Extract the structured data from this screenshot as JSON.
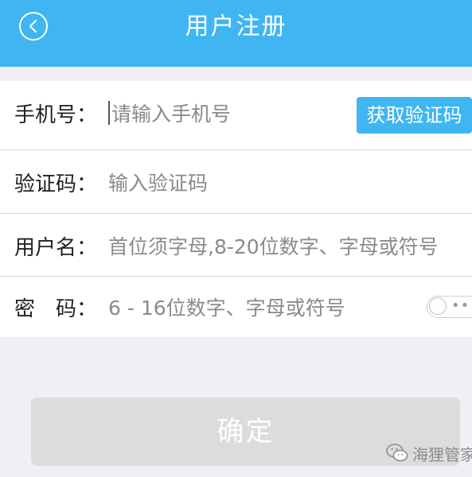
{
  "header": {
    "title": "用户注册",
    "back_icon": "back-arrow-icon"
  },
  "form": {
    "phone": {
      "label": "手机号：",
      "placeholder": "请输入手机号",
      "button": "获取验证码"
    },
    "code": {
      "label": "验证码：",
      "placeholder": "输入验证码"
    },
    "username": {
      "label": "用户名：",
      "placeholder": "首位须字母,8-20位数字、字母或符号"
    },
    "password": {
      "label": "密　码：",
      "placeholder": "6 - 16位数字、字母或符号",
      "toggle_icon": "password-visibility-toggle-icon"
    }
  },
  "actions": {
    "confirm": "确定"
  },
  "watermark": {
    "text": "海狸管家",
    "icon": "wechat-icon"
  },
  "colors": {
    "accent": "#3fb6f2",
    "background": "#efeff4",
    "disabled_button": "#dcdcdc"
  }
}
